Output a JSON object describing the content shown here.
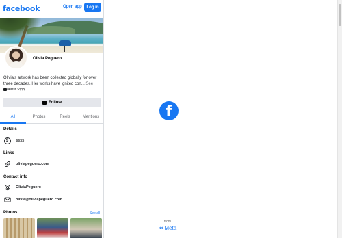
{
  "header": {
    "logo": "facebook",
    "open_app": "Open app",
    "login": "Log in"
  },
  "profile": {
    "name": "Olivia Peguero",
    "bio": "Olivia's artwork has been collected globally for over three decades. Her works have ignited con...",
    "see_more": "See more",
    "category": "Artist",
    "price": "$$$$",
    "follow": "Follow"
  },
  "tabs": [
    {
      "label": "All",
      "active": true
    },
    {
      "label": "Photos",
      "active": false
    },
    {
      "label": "Reels",
      "active": false
    },
    {
      "label": "Mentions",
      "active": false
    }
  ],
  "details": {
    "title": "Details",
    "price": "$$$$"
  },
  "links": {
    "title": "Links",
    "website": "oliviapeguero.com"
  },
  "contact": {
    "title": "Contact info",
    "instagram": "OliviaPeguero",
    "email": "olivia@oliviapeguero.com"
  },
  "photos": {
    "title": "Photos",
    "see_all": "See all"
  },
  "splash": {
    "from": "from",
    "brand": "Meta"
  },
  "colors": {
    "brand_blue": "#1877f2",
    "button_gray": "#e4e6eb",
    "muted_text": "#65676b"
  }
}
